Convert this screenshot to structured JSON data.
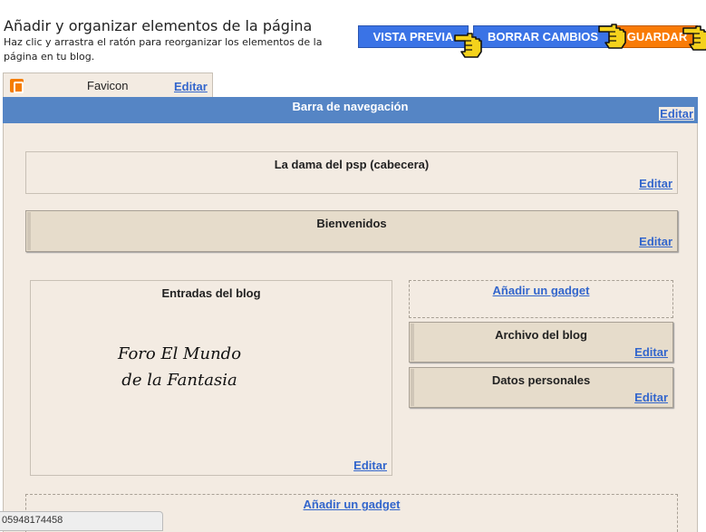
{
  "header": {
    "title": "Añadir y organizar elementos de la página",
    "subtitle": "Haz clic y arrastra el ratón para reorganizar los elementos de la página en tu blog."
  },
  "toolbar": {
    "preview_label": "VISTA PREVIA",
    "clear_label": "BORRAR CAMBIOS",
    "save_label": "GUARDAR"
  },
  "favicon": {
    "label": "Favicon",
    "edit": "Editar"
  },
  "navbar": {
    "title": "Barra de navegación",
    "edit": "Editar"
  },
  "header_widget": {
    "title": "La dama del psp (cabecera)",
    "edit": "Editar"
  },
  "welcome_widget": {
    "title": "Bienvenidos",
    "edit": "Editar"
  },
  "posts_widget": {
    "title": "Entradas del blog",
    "image_text_line1": "Foro El Mundo",
    "image_text_line2": "de la Fantasia",
    "edit": "Editar"
  },
  "sidebar": {
    "add_gadget": "Añadir un gadget",
    "archive": {
      "title": "Archivo del blog",
      "edit": "Editar"
    },
    "profile": {
      "title": "Datos personales",
      "edit": "Editar"
    }
  },
  "footer": {
    "add_gadget": "Añadir un gadget"
  },
  "status_bar": {
    "text": "05948174458"
  },
  "colors": {
    "button_blue": "#3a73e6",
    "button_orange": "#f97b06",
    "navbar_blue": "#5585c5",
    "layout_background": "#f3ebe2",
    "widget_background": "#e6dccb",
    "link_blue": "#3366cc"
  },
  "icons": [
    "hand-pointer-icon",
    "blogger-icon"
  ]
}
